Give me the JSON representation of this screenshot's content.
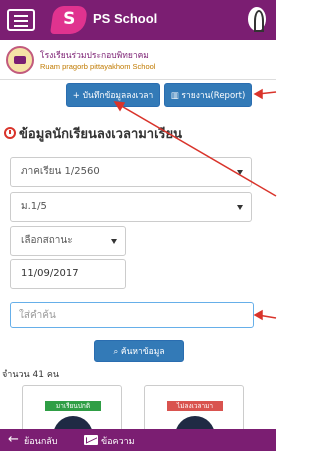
{
  "header": {
    "app_title": "PS School"
  },
  "school": {
    "name_th": "โรงเรียนร่วมประกอบพิทยาคม",
    "name_en": "Ruam pragorb pittayakhom School"
  },
  "actions": {
    "record_label": "บันทึกข้อมูลลงเวลา",
    "report_label": "รายงาน(Report)"
  },
  "section": {
    "title": "ข้อมูลนักเรียนลงเวลามาเรียน"
  },
  "filters": {
    "term": "ภาคเรียน 1/2560",
    "class": "ม.1/5",
    "status": "เลือกสถานะ",
    "date": "11/09/2017",
    "search_placeholder": "ใส่คำค้น",
    "search_button": "ค้นหาข้อมูล"
  },
  "summary": {
    "count_text": "จำนวน 41 คน"
  },
  "students": [
    {
      "status_label": "มาเรียนปกติ",
      "status_color": "#2f9e45"
    },
    {
      "status_label": "ไม่ลงเวลามา",
      "status_color": "#d9534f"
    }
  ],
  "footer": {
    "back_label": "ย้อนกลับ",
    "message_label": "ข้อความ"
  },
  "colors": {
    "brand": "#7b1e72",
    "primary_button": "#337ab7",
    "annotation": "#d9342b"
  }
}
